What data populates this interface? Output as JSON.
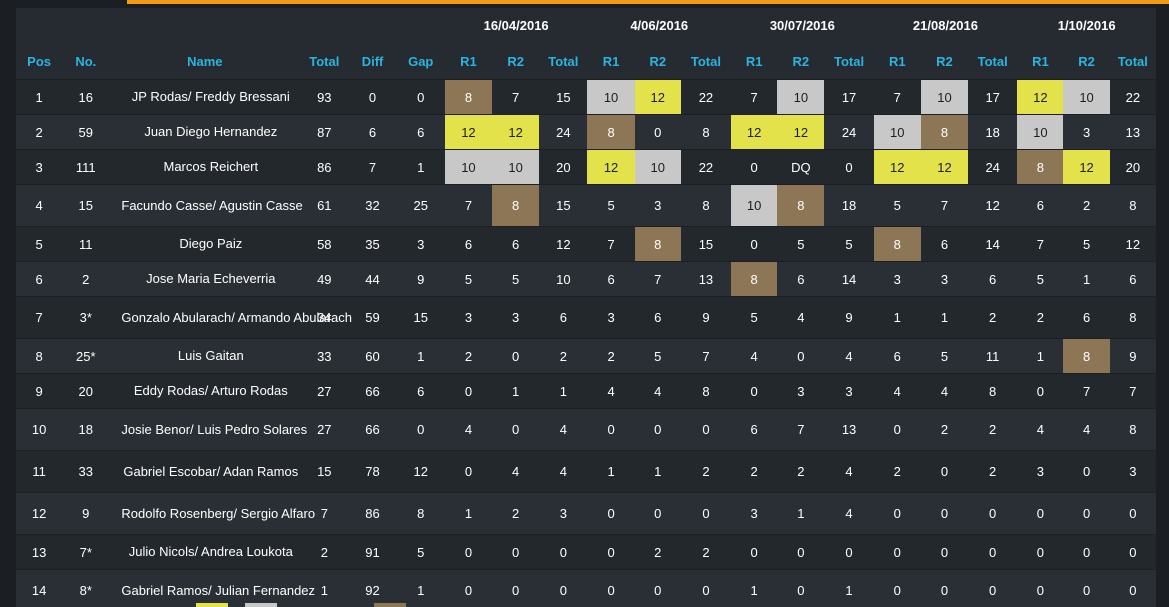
{
  "header": {
    "dates": [
      "16/04/2016",
      "4/06/2016",
      "30/07/2016",
      "21/08/2016",
      "1/10/2016"
    ],
    "columns": {
      "pos": "Pos",
      "no": "No.",
      "name": "Name",
      "total": "Total",
      "diff": "Diff",
      "gap": "Gap",
      "r1": "R1",
      "r2": "R2",
      "event_total": "Total"
    }
  },
  "colors": {
    "accent": "#f39c12",
    "header_text": "#2ab4e0",
    "gold": "#e3e24a",
    "silver": "#c8c8c8",
    "bronze": "#8c7655"
  },
  "rows": [
    {
      "pos": "1",
      "no": "16",
      "name": "JP Rodas/ Freddy Bressani",
      "total": "93",
      "diff": "0",
      "gap": "0",
      "events": [
        [
          "8",
          "7",
          "15"
        ],
        [
          "10",
          "12",
          "22"
        ],
        [
          "7",
          "10",
          "17"
        ],
        [
          "7",
          "10",
          "17"
        ],
        [
          "12",
          "10",
          "22"
        ]
      ],
      "highlights": [
        [
          "bronze",
          "",
          ""
        ],
        [
          "silver",
          "gold",
          ""
        ],
        [
          "",
          "silver",
          ""
        ],
        [
          "",
          "silver",
          ""
        ],
        [
          "gold",
          "silver",
          ""
        ]
      ]
    },
    {
      "pos": "2",
      "no": "59",
      "name": "Juan Diego Hernandez",
      "total": "87",
      "diff": "6",
      "gap": "6",
      "events": [
        [
          "12",
          "12",
          "24"
        ],
        [
          "8",
          "0",
          "8"
        ],
        [
          "12",
          "12",
          "24"
        ],
        [
          "10",
          "8",
          "18"
        ],
        [
          "10",
          "3",
          "13"
        ]
      ],
      "highlights": [
        [
          "gold",
          "gold",
          ""
        ],
        [
          "bronze",
          "",
          ""
        ],
        [
          "gold",
          "gold",
          ""
        ],
        [
          "silver",
          "bronze",
          ""
        ],
        [
          "silver",
          "",
          ""
        ]
      ]
    },
    {
      "pos": "3",
      "no": "111",
      "name": "Marcos Reichert",
      "total": "86",
      "diff": "7",
      "gap": "1",
      "events": [
        [
          "10",
          "10",
          "20"
        ],
        [
          "12",
          "10",
          "22"
        ],
        [
          "0",
          "DQ",
          "0"
        ],
        [
          "12",
          "12",
          "24"
        ],
        [
          "8",
          "12",
          "20"
        ]
      ],
      "highlights": [
        [
          "silver",
          "silver",
          ""
        ],
        [
          "gold",
          "silver",
          ""
        ],
        [
          "",
          "",
          ""
        ],
        [
          "gold",
          "gold",
          ""
        ],
        [
          "bronze",
          "gold",
          ""
        ]
      ]
    },
    {
      "pos": "4",
      "no": "15",
      "name": "Facundo Casse/ Agustin Casse",
      "total": "61",
      "diff": "32",
      "gap": "25",
      "events": [
        [
          "7",
          "8",
          "15"
        ],
        [
          "5",
          "3",
          "8"
        ],
        [
          "10",
          "8",
          "18"
        ],
        [
          "5",
          "7",
          "12"
        ],
        [
          "6",
          "2",
          "8"
        ]
      ],
      "highlights": [
        [
          "",
          "bronze",
          ""
        ],
        [
          "",
          "",
          ""
        ],
        [
          "silver",
          "bronze",
          ""
        ],
        [
          "",
          "",
          ""
        ],
        [
          "",
          "",
          ""
        ]
      ]
    },
    {
      "pos": "5",
      "no": "11",
      "name": "Diego Paiz",
      "total": "58",
      "diff": "35",
      "gap": "3",
      "events": [
        [
          "6",
          "6",
          "12"
        ],
        [
          "7",
          "8",
          "15"
        ],
        [
          "0",
          "5",
          "5"
        ],
        [
          "8",
          "6",
          "14"
        ],
        [
          "7",
          "5",
          "12"
        ]
      ],
      "highlights": [
        [
          "",
          "",
          ""
        ],
        [
          "",
          "bronze",
          ""
        ],
        [
          "",
          "",
          ""
        ],
        [
          "bronze",
          "",
          ""
        ],
        [
          "",
          "",
          ""
        ]
      ]
    },
    {
      "pos": "6",
      "no": "2",
      "name": "Jose Maria Echeverria",
      "total": "49",
      "diff": "44",
      "gap": "9",
      "events": [
        [
          "5",
          "5",
          "10"
        ],
        [
          "6",
          "7",
          "13"
        ],
        [
          "8",
          "6",
          "14"
        ],
        [
          "3",
          "3",
          "6"
        ],
        [
          "5",
          "1",
          "6"
        ]
      ],
      "highlights": [
        [
          "",
          "",
          ""
        ],
        [
          "",
          "",
          ""
        ],
        [
          "bronze",
          "",
          ""
        ],
        [
          "",
          "",
          ""
        ],
        [
          "",
          "",
          ""
        ]
      ]
    },
    {
      "pos": "7",
      "no": "3*",
      "name": "Gonzalo Abularach/ Armando Abularach",
      "total": "34",
      "diff": "59",
      "gap": "15",
      "events": [
        [
          "3",
          "3",
          "6"
        ],
        [
          "3",
          "6",
          "9"
        ],
        [
          "5",
          "4",
          "9"
        ],
        [
          "1",
          "1",
          "2"
        ],
        [
          "2",
          "6",
          "8"
        ]
      ],
      "highlights": [
        [
          "",
          "",
          ""
        ],
        [
          "",
          "",
          ""
        ],
        [
          "",
          "",
          ""
        ],
        [
          "",
          "",
          ""
        ],
        [
          "",
          "",
          ""
        ]
      ]
    },
    {
      "pos": "8",
      "no": "25*",
      "name": "Luis Gaitan",
      "total": "33",
      "diff": "60",
      "gap": "1",
      "events": [
        [
          "2",
          "0",
          "2"
        ],
        [
          "2",
          "5",
          "7"
        ],
        [
          "4",
          "0",
          "4"
        ],
        [
          "6",
          "5",
          "11"
        ],
        [
          "1",
          "8",
          "9"
        ]
      ],
      "highlights": [
        [
          "",
          "",
          ""
        ],
        [
          "",
          "",
          ""
        ],
        [
          "",
          "",
          ""
        ],
        [
          "",
          "",
          ""
        ],
        [
          "",
          "bronze",
          ""
        ]
      ]
    },
    {
      "pos": "9",
      "no": "20",
      "name": "Eddy Rodas/ Arturo Rodas",
      "total": "27",
      "diff": "66",
      "gap": "6",
      "events": [
        [
          "0",
          "1",
          "1"
        ],
        [
          "4",
          "4",
          "8"
        ],
        [
          "0",
          "3",
          "3"
        ],
        [
          "4",
          "4",
          "8"
        ],
        [
          "0",
          "7",
          "7"
        ]
      ],
      "highlights": [
        [
          "",
          "",
          ""
        ],
        [
          "",
          "",
          ""
        ],
        [
          "",
          "",
          ""
        ],
        [
          "",
          "",
          ""
        ],
        [
          "",
          "",
          ""
        ]
      ]
    },
    {
      "pos": "10",
      "no": "18",
      "name": "Josie Benor/ Luis Pedro Solares",
      "total": "27",
      "diff": "66",
      "gap": "0",
      "events": [
        [
          "4",
          "0",
          "4"
        ],
        [
          "0",
          "0",
          "0"
        ],
        [
          "6",
          "7",
          "13"
        ],
        [
          "0",
          "2",
          "2"
        ],
        [
          "4",
          "4",
          "8"
        ]
      ],
      "highlights": [
        [
          "",
          "",
          ""
        ],
        [
          "",
          "",
          ""
        ],
        [
          "",
          "",
          ""
        ],
        [
          "",
          "",
          ""
        ],
        [
          "",
          "",
          ""
        ]
      ]
    },
    {
      "pos": "11",
      "no": "33",
      "name": "Gabriel Escobar/ Adan Ramos",
      "total": "15",
      "diff": "78",
      "gap": "12",
      "events": [
        [
          "0",
          "4",
          "4"
        ],
        [
          "1",
          "1",
          "2"
        ],
        [
          "2",
          "2",
          "4"
        ],
        [
          "2",
          "0",
          "2"
        ],
        [
          "3",
          "0",
          "3"
        ]
      ],
      "highlights": [
        [
          "",
          "",
          ""
        ],
        [
          "",
          "",
          ""
        ],
        [
          "",
          "",
          ""
        ],
        [
          "",
          "",
          ""
        ],
        [
          "",
          "",
          ""
        ]
      ]
    },
    {
      "pos": "12",
      "no": "9",
      "name": "Rodolfo Rosenberg/ Sergio Alfaro",
      "total": "7",
      "diff": "86",
      "gap": "8",
      "events": [
        [
          "1",
          "2",
          "3"
        ],
        [
          "0",
          "0",
          "0"
        ],
        [
          "3",
          "1",
          "4"
        ],
        [
          "0",
          "0",
          "0"
        ],
        [
          "0",
          "0",
          "0"
        ]
      ],
      "highlights": [
        [
          "",
          "",
          ""
        ],
        [
          "",
          "",
          ""
        ],
        [
          "",
          "",
          ""
        ],
        [
          "",
          "",
          ""
        ],
        [
          "",
          "",
          ""
        ]
      ]
    },
    {
      "pos": "13",
      "no": "7*",
      "name": "Julio Nicols/ Andrea Loukota",
      "total": "2",
      "diff": "91",
      "gap": "5",
      "events": [
        [
          "0",
          "0",
          "0"
        ],
        [
          "0",
          "2",
          "2"
        ],
        [
          "0",
          "0",
          "0"
        ],
        [
          "0",
          "0",
          "0"
        ],
        [
          "0",
          "0",
          "0"
        ]
      ],
      "highlights": [
        [
          "",
          "",
          ""
        ],
        [
          "",
          "",
          ""
        ],
        [
          "",
          "",
          ""
        ],
        [
          "",
          "",
          ""
        ],
        [
          "",
          "",
          ""
        ]
      ]
    },
    {
      "pos": "14",
      "no": "8*",
      "name": "Gabriel Ramos/ Julian Fernandez",
      "total": "1",
      "diff": "92",
      "gap": "1",
      "events": [
        [
          "0",
          "0",
          "0"
        ],
        [
          "0",
          "0",
          "0"
        ],
        [
          "1",
          "0",
          "1"
        ],
        [
          "0",
          "0",
          "0"
        ],
        [
          "0",
          "0",
          "0"
        ]
      ],
      "highlights": [
        [
          "",
          "",
          ""
        ],
        [
          "",
          "",
          ""
        ],
        [
          "",
          "",
          ""
        ],
        [
          "",
          "",
          ""
        ],
        [
          "",
          "",
          ""
        ]
      ]
    }
  ]
}
